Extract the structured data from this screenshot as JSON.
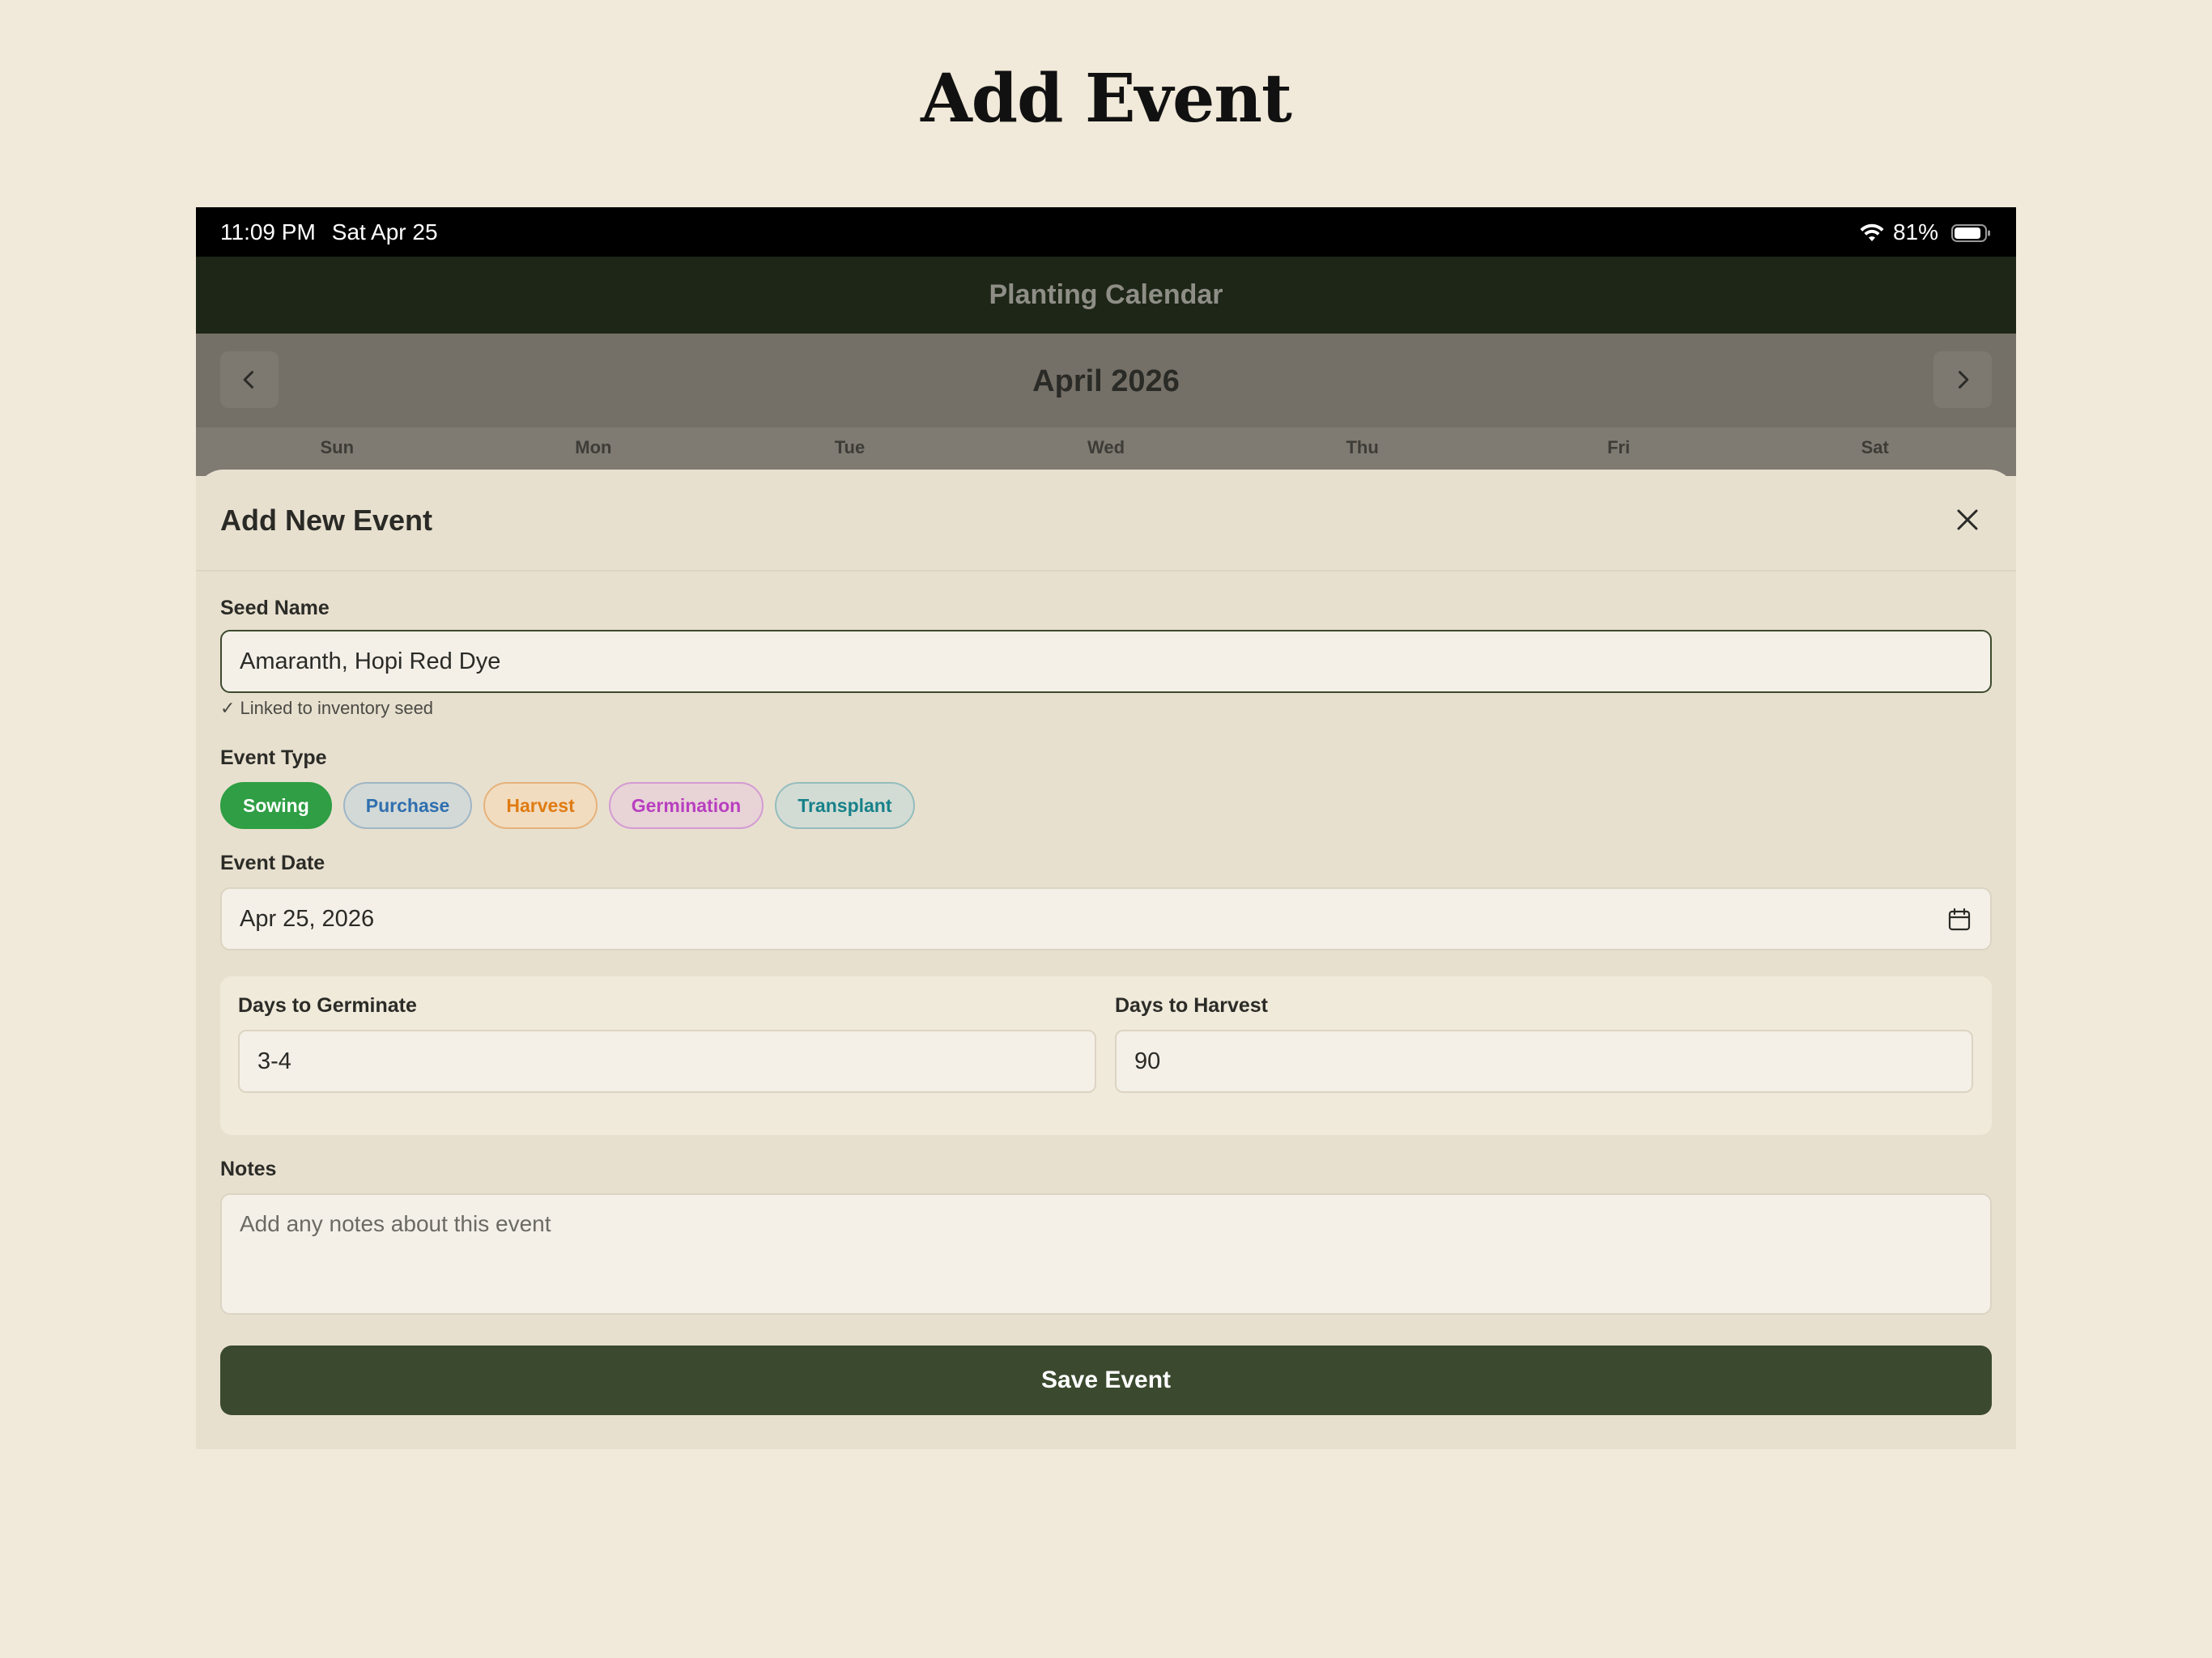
{
  "page": {
    "title": "Add Event"
  },
  "status_bar": {
    "time": "11:09 PM",
    "date": "Sat Apr 25",
    "battery": "81%"
  },
  "app": {
    "title": "Planting Calendar"
  },
  "calendar": {
    "month": "April 2026",
    "weekdays": [
      "Sun",
      "Mon",
      "Tue",
      "Wed",
      "Thu",
      "Fri",
      "Sat"
    ]
  },
  "sheet": {
    "title": "Add New Event",
    "seed_name": {
      "label": "Seed Name",
      "value": "Amaranth, Hopi Red Dye",
      "linked_note": "✓ Linked to inventory seed"
    },
    "event_type": {
      "label": "Event Type",
      "options": [
        {
          "label": "Sowing",
          "color": "#ffffff",
          "bg": "#2f9e44",
          "border": "#2f9e44",
          "selected": true
        },
        {
          "label": "Purchase",
          "color": "#2f6fb0",
          "bg": "#d3d9d6",
          "border": "#9fb6c6",
          "selected": false
        },
        {
          "label": "Harvest",
          "color": "#e07b12",
          "bg": "#f1dcc0",
          "border": "#e6b27a",
          "selected": false
        },
        {
          "label": "Germination",
          "color": "#b83fc0",
          "bg": "#e8d3d6",
          "border": "#d39bd3",
          "selected": false
        },
        {
          "label": "Transplant",
          "color": "#17818a",
          "bg": "#d3dcd4",
          "border": "#93bdbd",
          "selected": false
        }
      ]
    },
    "event_date": {
      "label": "Event Date",
      "value": "Apr 25, 2026"
    },
    "days_to_germinate": {
      "label": "Days to Germinate",
      "value": "3-4"
    },
    "days_to_harvest": {
      "label": "Days to Harvest",
      "value": "90"
    },
    "notes": {
      "label": "Notes",
      "placeholder": "Add any notes about this event"
    },
    "save_label": "Save Event"
  }
}
